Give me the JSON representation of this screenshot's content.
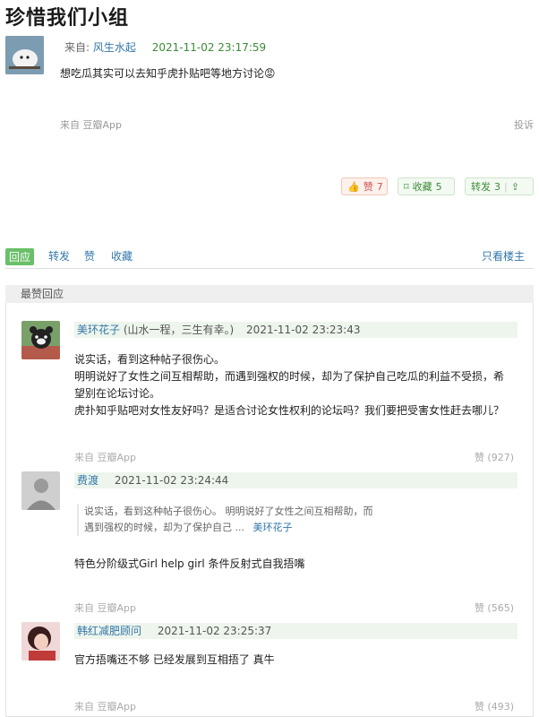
{
  "page": {
    "title": "珍惜我们小组"
  },
  "post": {
    "from_label": "来自:",
    "author": "风生水起",
    "datetime": "2021-11-02 23:17:59",
    "body": "想吃瓜其实可以去知乎虎扑贴吧等地方讨论😡",
    "source": "来自 豆瓣App",
    "report": "投诉",
    "actions": {
      "like": {
        "label": "赞",
        "count": "7"
      },
      "collect": {
        "label": "收藏",
        "count": "5"
      },
      "share": {
        "label": "转发",
        "count": "3"
      }
    }
  },
  "tabs": {
    "reply": "回应",
    "repost": "转发",
    "like": "赞",
    "collect": "收藏",
    "only_op": "只看楼主"
  },
  "section": {
    "title": "最赞回应"
  },
  "replies": [
    {
      "author": "美环花子",
      "sig": "(山水一程，三生有幸。)",
      "datetime": "2021-11-02 23:23:43",
      "lines": [
        "说实话，看到这种帖子很伤心。",
        "明明说好了女性之间互相帮助，而遇到强权的时候，却为了保护自己吃瓜的利益不受损，希",
        "望别在论坛讨论。",
        "虎扑知乎贴吧对女性友好吗？是适合讨论女性权利的论坛吗？我们要把受害女性赶去哪儿？"
      ],
      "source": "来自 豆瓣App",
      "likes": "赞 (927)"
    },
    {
      "author": "费渡",
      "datetime": "2021-11-02 23:24:44",
      "quote_lines": [
        "说实话，看到这种帖子很伤心。 明明说好了女性之间互相帮助，而",
        "遇到强权的时候，却为了保护自己 ..."
      ],
      "quote_author": "美环花子",
      "lines": [
        "特色分阶级式Girl help girl 条件反射式自我捂嘴"
      ],
      "source": "来自 豆瓣App",
      "likes": "赞 (565)"
    },
    {
      "author": "韩红减肥顾问",
      "datetime": "2021-11-02 23:25:37",
      "lines": [
        "官方捂嘴还不够 已经发展到互相捂了 真牛"
      ],
      "source": "来自 豆瓣App",
      "likes": "赞 (493)"
    }
  ]
}
